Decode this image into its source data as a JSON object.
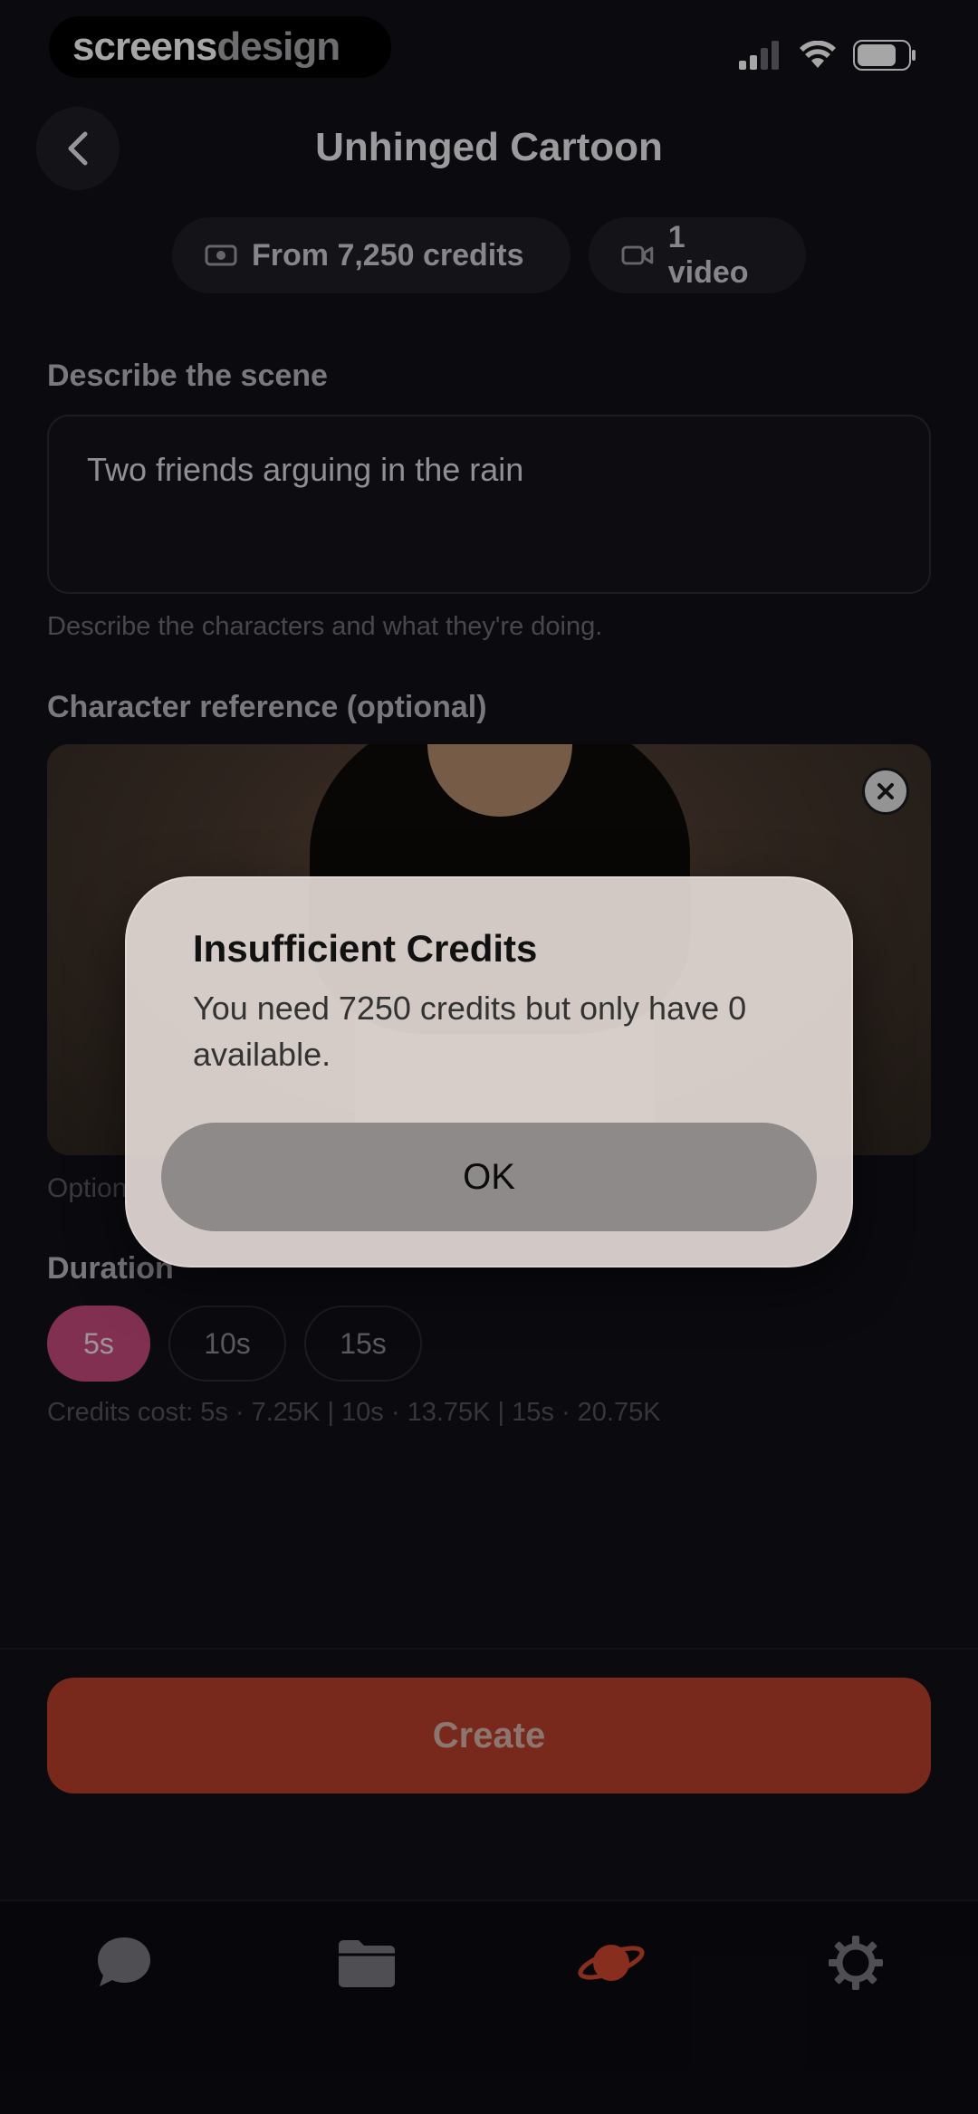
{
  "status_bar": {
    "brand_part1": "screens",
    "brand_part2": "design"
  },
  "header": {
    "title": "Unhinged Cartoon",
    "back_icon": "chevron-left-icon"
  },
  "chips": {
    "credits": "From 7,250 credits",
    "video": "1 video"
  },
  "scene": {
    "label": "Describe the scene",
    "value": "Two friends arguing in the rain",
    "helper": "Describe the characters and what they're doing."
  },
  "character": {
    "label": "Character reference (optional)",
    "helper_partial": "Option"
  },
  "duration": {
    "label": "Duration",
    "options": [
      "5s",
      "10s",
      "15s"
    ],
    "selected": "5s",
    "cost_line": "Credits cost: 5s · 7.25K | 10s · 13.75K | 15s · 20.75K"
  },
  "create_label": "Create",
  "tabbar": {
    "icons": [
      "chat-icon",
      "folder-icon",
      "planet-icon",
      "gear-icon"
    ],
    "active_index": 2
  },
  "alert": {
    "title": "Insufficient Credits",
    "message": "You need 7250 credits but only have 0 available.",
    "ok_label": "OK"
  },
  "colors": {
    "accent_pink": "#c64a7d",
    "create_red": "#b8402a",
    "planet_active": "#d2472e"
  }
}
